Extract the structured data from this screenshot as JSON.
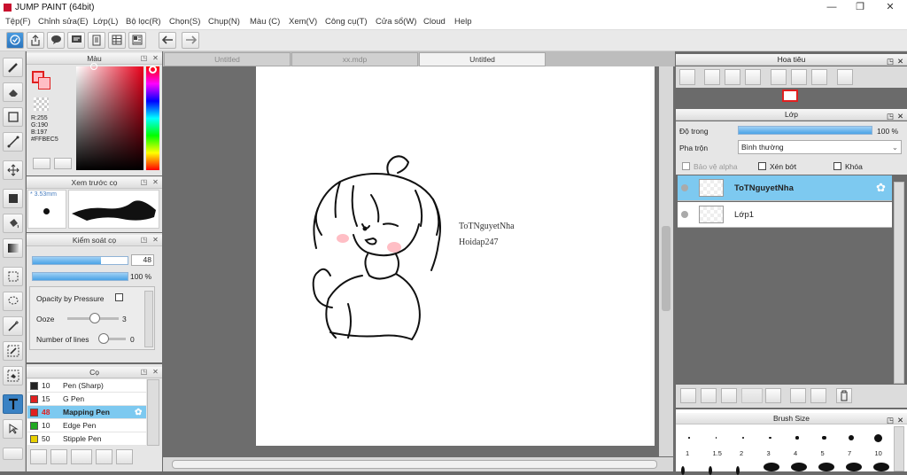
{
  "app": {
    "title": "JUMP PAINT (64bit)"
  },
  "window_controls": {
    "minimize": "—",
    "maximize": "❐",
    "close": "✕"
  },
  "menu": [
    "Tệp(F)",
    "Chỉnh sửa(E)",
    "Lớp(L)",
    "Bộ lọc(R)",
    "Chọn(S)",
    "Chụp(N)",
    "Màu (C)",
    "Xem(V)",
    "Công cụ(T)",
    "Cửa sổ(W)",
    "Cloud",
    "Help"
  ],
  "color_panel": {
    "title": "Màu",
    "r": "R:255",
    "g": "G:190",
    "b": "B:197",
    "hex": "#FFBEC5",
    "current_color": "#FFBEC5"
  },
  "brush_preview": {
    "title": "Xem trước cọ",
    "size": "* 3.53mm"
  },
  "brush_control": {
    "title": "Kiểm soát cọ",
    "size_value": "48",
    "size_fraction": 0.72,
    "opacity_value": "100 %",
    "opacity_fraction": 1.0,
    "opacity_by_pressure": "Opacity by Pressure",
    "ooze_label": "Ooze",
    "ooze_value": "3",
    "lines_label": "Number of lines",
    "lines_value": "0"
  },
  "brushes": {
    "title": "Cọ",
    "items": [
      {
        "size": "10",
        "name": "Pen (Sharp)",
        "color": "#222222"
      },
      {
        "size": "15",
        "name": "G Pen",
        "color": "#e02020"
      },
      {
        "size": "48",
        "name": "Mapping Pen",
        "color": "#e02020"
      },
      {
        "size": "10",
        "name": "Edge Pen",
        "color": "#22aa22"
      },
      {
        "size": "50",
        "name": "Stipple Pen",
        "color": "#e8d000"
      }
    ]
  },
  "tabs": [
    {
      "label": "Untitled"
    },
    {
      "label": "xx.mdp"
    },
    {
      "label": "Untitled"
    }
  ],
  "canvas": {
    "text1": "ToTNguyetNha",
    "text2": "Hoidap247"
  },
  "navigator": {
    "title": "Hoa tiêu"
  },
  "layers": {
    "title": "Lớp",
    "opacity_label": "Độ trong",
    "opacity_value": "100 %",
    "opacity_fraction": 1.0,
    "blend_label": "Pha trộn",
    "blend_value": "Bình thường",
    "protect_alpha": "Bảo vệ alpha",
    "clipping": "Xén bớt",
    "lock": "Khóa",
    "items": [
      {
        "name": "ToTNguyetNha"
      },
      {
        "name": "Lớp1"
      }
    ]
  },
  "brush_size": {
    "title": "Brush Size",
    "sizes": [
      "1",
      "1.5",
      "2",
      "3",
      "4",
      "5",
      "7",
      "10"
    ],
    "dot_diameters": [
      1,
      1.5,
      2,
      3,
      4,
      5,
      7,
      10
    ]
  }
}
